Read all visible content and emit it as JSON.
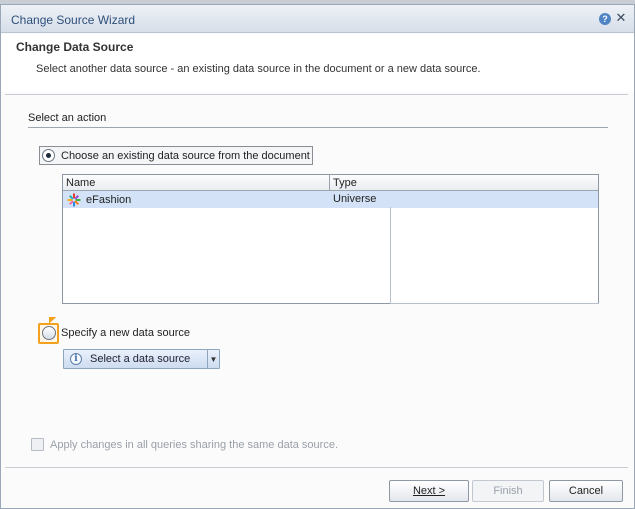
{
  "window": {
    "title": "Change Source Wizard"
  },
  "header": {
    "title": "Change Data Source",
    "description": "Select another data source - an existing data source in the document or a new data source."
  },
  "action_section": {
    "label": "Select an action",
    "existing_option": {
      "label": "Choose an existing data source from the document",
      "selected": true
    },
    "table": {
      "columns": [
        "Name",
        "Type"
      ],
      "rows": [
        {
          "name": "eFashion",
          "type": "Universe",
          "icon": "universe-icon",
          "selected": true
        }
      ]
    },
    "new_option": {
      "label": "Specify a new data source",
      "selected": false
    },
    "dropdown": {
      "label": "Select a data source",
      "icon": "info-icon"
    }
  },
  "apply_checkbox": {
    "label": "Apply changes in all queries sharing the same data source.",
    "checked": false,
    "enabled": false
  },
  "buttons": {
    "next": "Next >",
    "finish": "Finish",
    "cancel": "Cancel"
  },
  "colors": {
    "title_text": "#2e4f79",
    "selected_row": "#d3e2f6",
    "focus_ring": "#f3a11e"
  }
}
